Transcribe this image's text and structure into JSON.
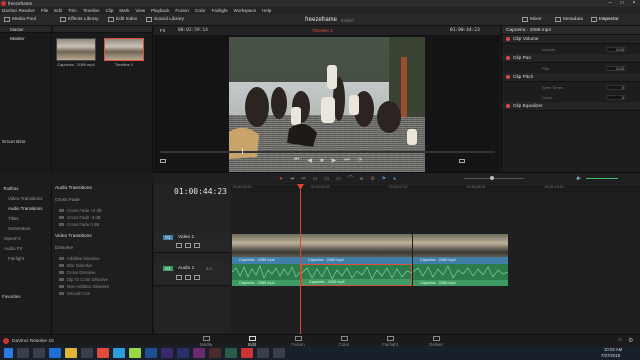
{
  "app": {
    "window_title": "freezeframe",
    "project_title": "freezeframe",
    "project_status": "Edited"
  },
  "menu": [
    "DaVinci Resolve",
    "File",
    "Edit",
    "Trim",
    "Timeline",
    "Clip",
    "Mark",
    "View",
    "Playback",
    "Fusion",
    "Color",
    "Fairlight",
    "Workspace",
    "Help"
  ],
  "toolbar": {
    "media_pool": "Media Pool",
    "effects_library": "Effects Library",
    "edit_index": "Edit Index",
    "sound_library": "Sound Library",
    "mixer": "Mixer",
    "metadata": "Metadata",
    "inspector": "Inspector"
  },
  "media": {
    "bins_header": "Master",
    "master_bin": "Master",
    "smart_bins": "Smart Bins",
    "items": [
      {
        "name": "Capoeira - 2089.mp4"
      },
      {
        "name": "Timeline 1"
      }
    ]
  },
  "viewer": {
    "zoom": "Fit",
    "source_tc": "00:02:59:14",
    "timeline_name": "Timeline 1",
    "record_tc": "01:00:44:23"
  },
  "inspector": {
    "clip_title": "Capoeira - 2089.mp4",
    "sections": [
      {
        "name": "Clip Volume",
        "rows": [
          {
            "label": "Volume",
            "value": "0.00"
          }
        ]
      },
      {
        "name": "Clip Pan",
        "rows": [
          {
            "label": "Pan",
            "value": "0.00"
          }
        ]
      },
      {
        "name": "Clip Pitch",
        "rows": [
          {
            "label": "Semi Tones",
            "value": "0"
          },
          {
            "label": "Cents",
            "value": "0"
          }
        ]
      },
      {
        "name": "Clip Equalizer",
        "rows": []
      }
    ]
  },
  "effects": {
    "toolbox": "Toolbox",
    "categories": [
      "Video Transitions",
      "Audio Transitions",
      "Titles",
      "Generators",
      "OpenFX",
      "Audio FX",
      "Fairlight"
    ],
    "favorites": "Favorites",
    "audio_transitions_header": "Audio Transitions",
    "crossfade_header": "Cross Fade",
    "crossfades": [
      "Cross Fade +3 dB",
      "Cross Fade -3 dB",
      "Cross Fade 0 dB"
    ],
    "video_transitions_header": "Video Transitions",
    "dissolve_header": "Dissolve",
    "dissolves": [
      "Additive Dissolve",
      "Blur Dissolve",
      "Cross Dissolve",
      "Dip To Color Dissolve",
      "Non-Additive Dissolve",
      "Smooth Cut"
    ]
  },
  "timeline": {
    "timecode": "01:00:44:23",
    "ruler": [
      "01:00:00:00",
      "01:00:18:22",
      "01:00:37:12",
      "01:00:56:04",
      "01:01:14:20"
    ],
    "video_track": {
      "id": "V1",
      "name": "Video 1",
      "clips": [
        "Capoeira - 2089.mp4",
        "Capoeira - 2089.mp4",
        "Capoeira - 2089.mp4"
      ]
    },
    "audio_track": {
      "id": "A1",
      "name": "Audio 1",
      "level": "2.0",
      "clips": [
        "Capoeira - 2089.mp4",
        "Capoeira - 2089.mp4",
        "Capoeira - 2089.mp4"
      ]
    }
  },
  "pages": [
    {
      "name": "Media",
      "active": false
    },
    {
      "name": "Edit",
      "active": true
    },
    {
      "name": "Fusion",
      "active": false
    },
    {
      "name": "Color",
      "active": false
    },
    {
      "name": "Fairlight",
      "active": false
    },
    {
      "name": "Deliver",
      "active": false
    }
  ],
  "footer": {
    "app_name": "DaVinci Resolve 15"
  },
  "taskbar": {
    "time": "10:02 AM",
    "date": "7/27/2018"
  },
  "colors": {
    "accent": "#d9513b",
    "video_clip": "#3f7fa8",
    "audio_clip": "#3e9c64",
    "playhead": "#e2452b"
  }
}
